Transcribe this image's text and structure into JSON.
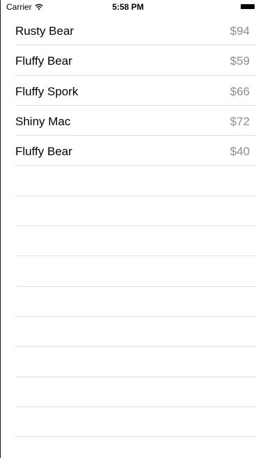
{
  "status_bar": {
    "carrier": "Carrier",
    "time": "5:58 PM",
    "wifi_icon": "wifi-icon",
    "battery_icon": "battery-icon"
  },
  "items": [
    {
      "name": "Rusty Bear",
      "price": "$94"
    },
    {
      "name": "Fluffy Bear",
      "price": "$59"
    },
    {
      "name": "Fluffy Spork",
      "price": "$66"
    },
    {
      "name": "Shiny Mac",
      "price": "$72"
    },
    {
      "name": "Fluffy Bear",
      "price": "$40"
    }
  ],
  "colors": {
    "text": "#000000",
    "secondary_text": "#8e8e93",
    "separator": "#e1e1e4",
    "background": "#ffffff"
  }
}
